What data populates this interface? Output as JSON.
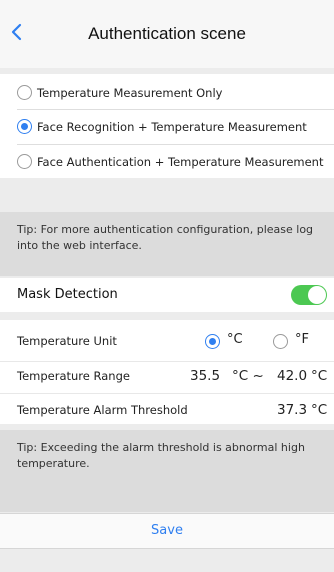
{
  "header": {
    "title": "Authentication scene"
  },
  "scene_options": [
    {
      "label": "Temperature Measurement Only",
      "selected": false
    },
    {
      "label": "Face Recognition + Temperature Measurement",
      "selected": true
    },
    {
      "label": "Face Authentication + Temperature Measurement",
      "selected": false
    }
  ],
  "tip_auth": "Tip: For more authentication configuration, please log into the web interface.",
  "mask_detection": {
    "label": "Mask Detection",
    "enabled": true
  },
  "temperature": {
    "unit_label": "Temperature Unit",
    "unit_options": [
      {
        "label": "°C",
        "selected": true
      },
      {
        "label": "°F",
        "selected": false
      }
    ],
    "range_label": "Temperature Range",
    "range_min": "35.5",
    "range_min_unit": "°C ~",
    "range_max": "42.0",
    "range_max_unit": "°C",
    "alarm_label": "Temperature Alarm Threshold",
    "alarm_value": "37.3",
    "alarm_unit": "°C"
  },
  "tip_alarm": "Tip: Exceeding the alarm threshold is abnormal high temperature.",
  "save_label": "Save",
  "colors": {
    "accent": "#2f7ff0",
    "toggle_on": "#4cc852"
  }
}
